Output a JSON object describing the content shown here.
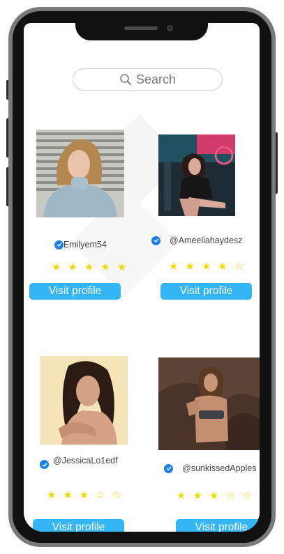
{
  "search": {
    "placeholder": "Search",
    "icon": "search-icon"
  },
  "profiles": [
    {
      "username": "Emilyem54",
      "rating": 5,
      "max_rating": 5,
      "button_label": "Visit profile"
    },
    {
      "username": "@Ameeliahaydesz",
      "rating": 4,
      "max_rating": 5,
      "button_label": "Visit profile"
    },
    {
      "username": "@JessicaLo1edf",
      "rating": 3,
      "max_rating": 5,
      "button_label": "Visit profile"
    },
    {
      "username": "@sunkissedApples",
      "rating": 3,
      "max_rating": 5,
      "button_label": "Visit profile"
    }
  ],
  "colors": {
    "accent": "#34b5f5",
    "star": "#f2dc00",
    "verified": "#1c7ee8"
  }
}
